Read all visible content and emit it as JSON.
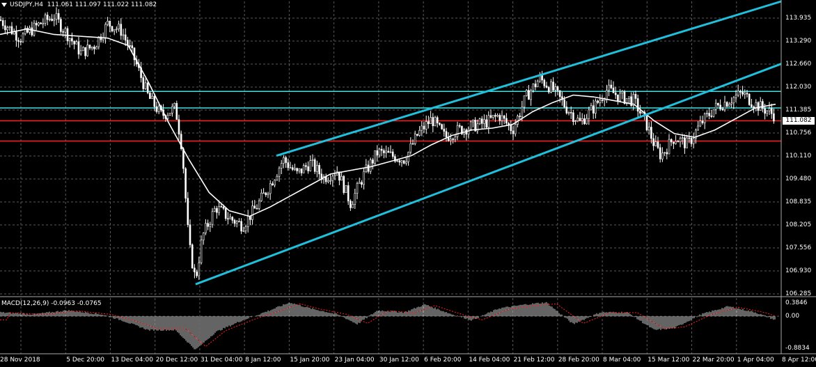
{
  "symbol_header": {
    "symbol": "USDJPY,H4",
    "ohlc": "111.061 111.097 111.022 111.082"
  },
  "macd_header": {
    "label": "MACD(12,26,9) -0.0963 -0.0765"
  },
  "current_price_label": "111.082",
  "colors": {
    "background": "#000000",
    "grid": "#5a5a5a",
    "candles": "#ffffff",
    "moving_average": "#ffffff",
    "channel_lines": "#20c0dd",
    "horizontal_cyan": "#40e0e0",
    "horizontal_red": "#ff2020",
    "macd_histogram": "#c8c8c8",
    "macd_signal": "#ff2020"
  },
  "y_axis_labels": [
    "113.935",
    "113.290",
    "112.660",
    "112.030",
    "111.385",
    "110.756",
    "110.110",
    "109.480",
    "108.835",
    "108.205",
    "107.556",
    "106.930",
    "106.285"
  ],
  "macd_axis_labels": [
    "0.3846",
    "0.00",
    "-0.8834"
  ],
  "x_axis_labels": [
    "28 Nov 2018",
    "5 Dec 20:00",
    "13 Dec 04:00",
    "20 Dec 12:00",
    "31 Dec 04:00",
    "8 Jan 12:00",
    "15 Jan 20:00",
    "23 Jan 04:00",
    "30 Jan 12:00",
    "6 Feb 20:00",
    "14 Feb 04:00",
    "21 Feb 12:00",
    "28 Feb 20:00",
    "8 Mar 04:00",
    "15 Mar 12:00",
    "22 Mar 20:00",
    "1 Apr 04:00",
    "8 Apr 12:00"
  ],
  "chart_data": {
    "type": "candlestick",
    "symbol": "USDJPY",
    "timeframe": "H4",
    "y_range": [
      106.2,
      114.2
    ],
    "macd_range": [
      -0.95,
      0.46
    ],
    "price_path": [
      {
        "x": 0,
        "y": 113.7
      },
      {
        "x": 3,
        "y": 113.2
      },
      {
        "x": 6,
        "y": 113.6
      },
      {
        "x": 8,
        "y": 113.8
      },
      {
        "x": 10,
        "y": 113.3
      },
      {
        "x": 12,
        "y": 112.8
      },
      {
        "x": 14,
        "y": 113.0
      },
      {
        "x": 16,
        "y": 113.6
      },
      {
        "x": 18,
        "y": 113.4
      },
      {
        "x": 20,
        "y": 112.6
      },
      {
        "x": 22,
        "y": 111.6
      },
      {
        "x": 24,
        "y": 111.1
      },
      {
        "x": 26,
        "y": 111.3
      },
      {
        "x": 27,
        "y": 110.2
      },
      {
        "x": 28,
        "y": 107.6
      },
      {
        "x": 29,
        "y": 106.6
      },
      {
        "x": 30,
        "y": 107.8
      },
      {
        "x": 32,
        "y": 108.6
      },
      {
        "x": 34,
        "y": 108.3
      },
      {
        "x": 36,
        "y": 108.1
      },
      {
        "x": 38,
        "y": 108.6
      },
      {
        "x": 40,
        "y": 109.2
      },
      {
        "x": 42,
        "y": 109.9
      },
      {
        "x": 44,
        "y": 109.5
      },
      {
        "x": 46,
        "y": 109.8
      },
      {
        "x": 48,
        "y": 109.4
      },
      {
        "x": 50,
        "y": 109.6
      },
      {
        "x": 52,
        "y": 108.7
      },
      {
        "x": 54,
        "y": 109.5
      },
      {
        "x": 56,
        "y": 110.1
      },
      {
        "x": 58,
        "y": 110.0
      },
      {
        "x": 60,
        "y": 109.9
      },
      {
        "x": 62,
        "y": 110.6
      },
      {
        "x": 64,
        "y": 111.0
      },
      {
        "x": 66,
        "y": 110.5
      },
      {
        "x": 68,
        "y": 110.7
      },
      {
        "x": 70,
        "y": 110.8
      },
      {
        "x": 72,
        "y": 110.9
      },
      {
        "x": 74,
        "y": 111.1
      },
      {
        "x": 76,
        "y": 110.7
      },
      {
        "x": 78,
        "y": 111.6
      },
      {
        "x": 80,
        "y": 112.1
      },
      {
        "x": 82,
        "y": 111.8
      },
      {
        "x": 84,
        "y": 111.3
      },
      {
        "x": 86,
        "y": 110.9
      },
      {
        "x": 88,
        "y": 111.3
      },
      {
        "x": 90,
        "y": 111.8
      },
      {
        "x": 92,
        "y": 111.6
      },
      {
        "x": 94,
        "y": 111.5
      },
      {
        "x": 96,
        "y": 110.8
      },
      {
        "x": 97,
        "y": 110.3
      },
      {
        "x": 98,
        "y": 110.0
      },
      {
        "x": 100,
        "y": 110.5
      },
      {
        "x": 102,
        "y": 110.3
      },
      {
        "x": 104,
        "y": 110.9
      },
      {
        "x": 106,
        "y": 111.3
      },
      {
        "x": 108,
        "y": 111.5
      },
      {
        "x": 110,
        "y": 111.7
      },
      {
        "x": 112,
        "y": 111.4
      },
      {
        "x": 114,
        "y": 111.2
      },
      {
        "x": 115,
        "y": 111.08
      }
    ],
    "moving_average": [
      {
        "x": 0,
        "y": 113.3
      },
      {
        "x": 4,
        "y": 113.45
      },
      {
        "x": 8,
        "y": 113.3
      },
      {
        "x": 12,
        "y": 113.25
      },
      {
        "x": 16,
        "y": 113.2
      },
      {
        "x": 19,
        "y": 113.0
      },
      {
        "x": 22,
        "y": 112.0
      },
      {
        "x": 25,
        "y": 110.9
      },
      {
        "x": 28,
        "y": 109.9
      },
      {
        "x": 31,
        "y": 109.0
      },
      {
        "x": 34,
        "y": 108.5
      },
      {
        "x": 37,
        "y": 108.35
      },
      {
        "x": 40,
        "y": 108.6
      },
      {
        "x": 43,
        "y": 108.9
      },
      {
        "x": 46,
        "y": 109.2
      },
      {
        "x": 49,
        "y": 109.5
      },
      {
        "x": 52,
        "y": 109.6
      },
      {
        "x": 55,
        "y": 109.7
      },
      {
        "x": 58,
        "y": 109.85
      },
      {
        "x": 61,
        "y": 110.0
      },
      {
        "x": 64,
        "y": 110.3
      },
      {
        "x": 67,
        "y": 110.55
      },
      {
        "x": 70,
        "y": 110.7
      },
      {
        "x": 73,
        "y": 110.75
      },
      {
        "x": 76,
        "y": 110.85
      },
      {
        "x": 79,
        "y": 111.2
      },
      {
        "x": 82,
        "y": 111.45
      },
      {
        "x": 85,
        "y": 111.65
      },
      {
        "x": 88,
        "y": 111.6
      },
      {
        "x": 91,
        "y": 111.5
      },
      {
        "x": 94,
        "y": 111.4
      },
      {
        "x": 97,
        "y": 110.95
      },
      {
        "x": 100,
        "y": 110.6
      },
      {
        "x": 103,
        "y": 110.5
      },
      {
        "x": 106,
        "y": 110.7
      },
      {
        "x": 109,
        "y": 111.0
      },
      {
        "x": 112,
        "y": 111.3
      },
      {
        "x": 115,
        "y": 111.4
      }
    ],
    "channel_lines": [
      {
        "name": "upper",
        "from": {
          "x": 41,
          "y": 110.0
        },
        "to": {
          "x": 115,
          "y": 114.2
        }
      },
      {
        "name": "lower",
        "from": {
          "x": 29,
          "y": 106.5
        },
        "to": {
          "x": 115,
          "y": 112.5
        }
      }
    ],
    "horizontal_levels": [
      {
        "y": 111.75,
        "color": "cyan"
      },
      {
        "y": 111.3,
        "color": "cyan"
      },
      {
        "y": 110.95,
        "color": "red"
      },
      {
        "y": 110.4,
        "color": "red"
      }
    ],
    "macd_histogram": [
      {
        "x": 0,
        "y": 0.1
      },
      {
        "x": 5,
        "y": 0.05
      },
      {
        "x": 10,
        "y": 0.15
      },
      {
        "x": 15,
        "y": 0.05
      },
      {
        "x": 18,
        "y": -0.1
      },
      {
        "x": 22,
        "y": -0.35
      },
      {
        "x": 26,
        "y": -0.35
      },
      {
        "x": 29,
        "y": -0.85
      },
      {
        "x": 32,
        "y": -0.4
      },
      {
        "x": 36,
        "y": -0.1
      },
      {
        "x": 40,
        "y": 0.15
      },
      {
        "x": 43,
        "y": 0.35
      },
      {
        "x": 46,
        "y": 0.2
      },
      {
        "x": 50,
        "y": 0.05
      },
      {
        "x": 53,
        "y": -0.2
      },
      {
        "x": 56,
        "y": 0.15
      },
      {
        "x": 60,
        "y": 0.1
      },
      {
        "x": 63,
        "y": 0.3
      },
      {
        "x": 67,
        "y": 0.05
      },
      {
        "x": 70,
        "y": -0.1
      },
      {
        "x": 74,
        "y": 0.2
      },
      {
        "x": 78,
        "y": 0.3
      },
      {
        "x": 81,
        "y": 0.35
      },
      {
        "x": 85,
        "y": -0.2
      },
      {
        "x": 89,
        "y": 0.1
      },
      {
        "x": 93,
        "y": 0.1
      },
      {
        "x": 97,
        "y": -0.35
      },
      {
        "x": 100,
        "y": -0.3
      },
      {
        "x": 104,
        "y": 0.05
      },
      {
        "x": 108,
        "y": 0.25
      },
      {
        "x": 112,
        "y": 0.1
      },
      {
        "x": 115,
        "y": -0.1
      }
    ]
  }
}
